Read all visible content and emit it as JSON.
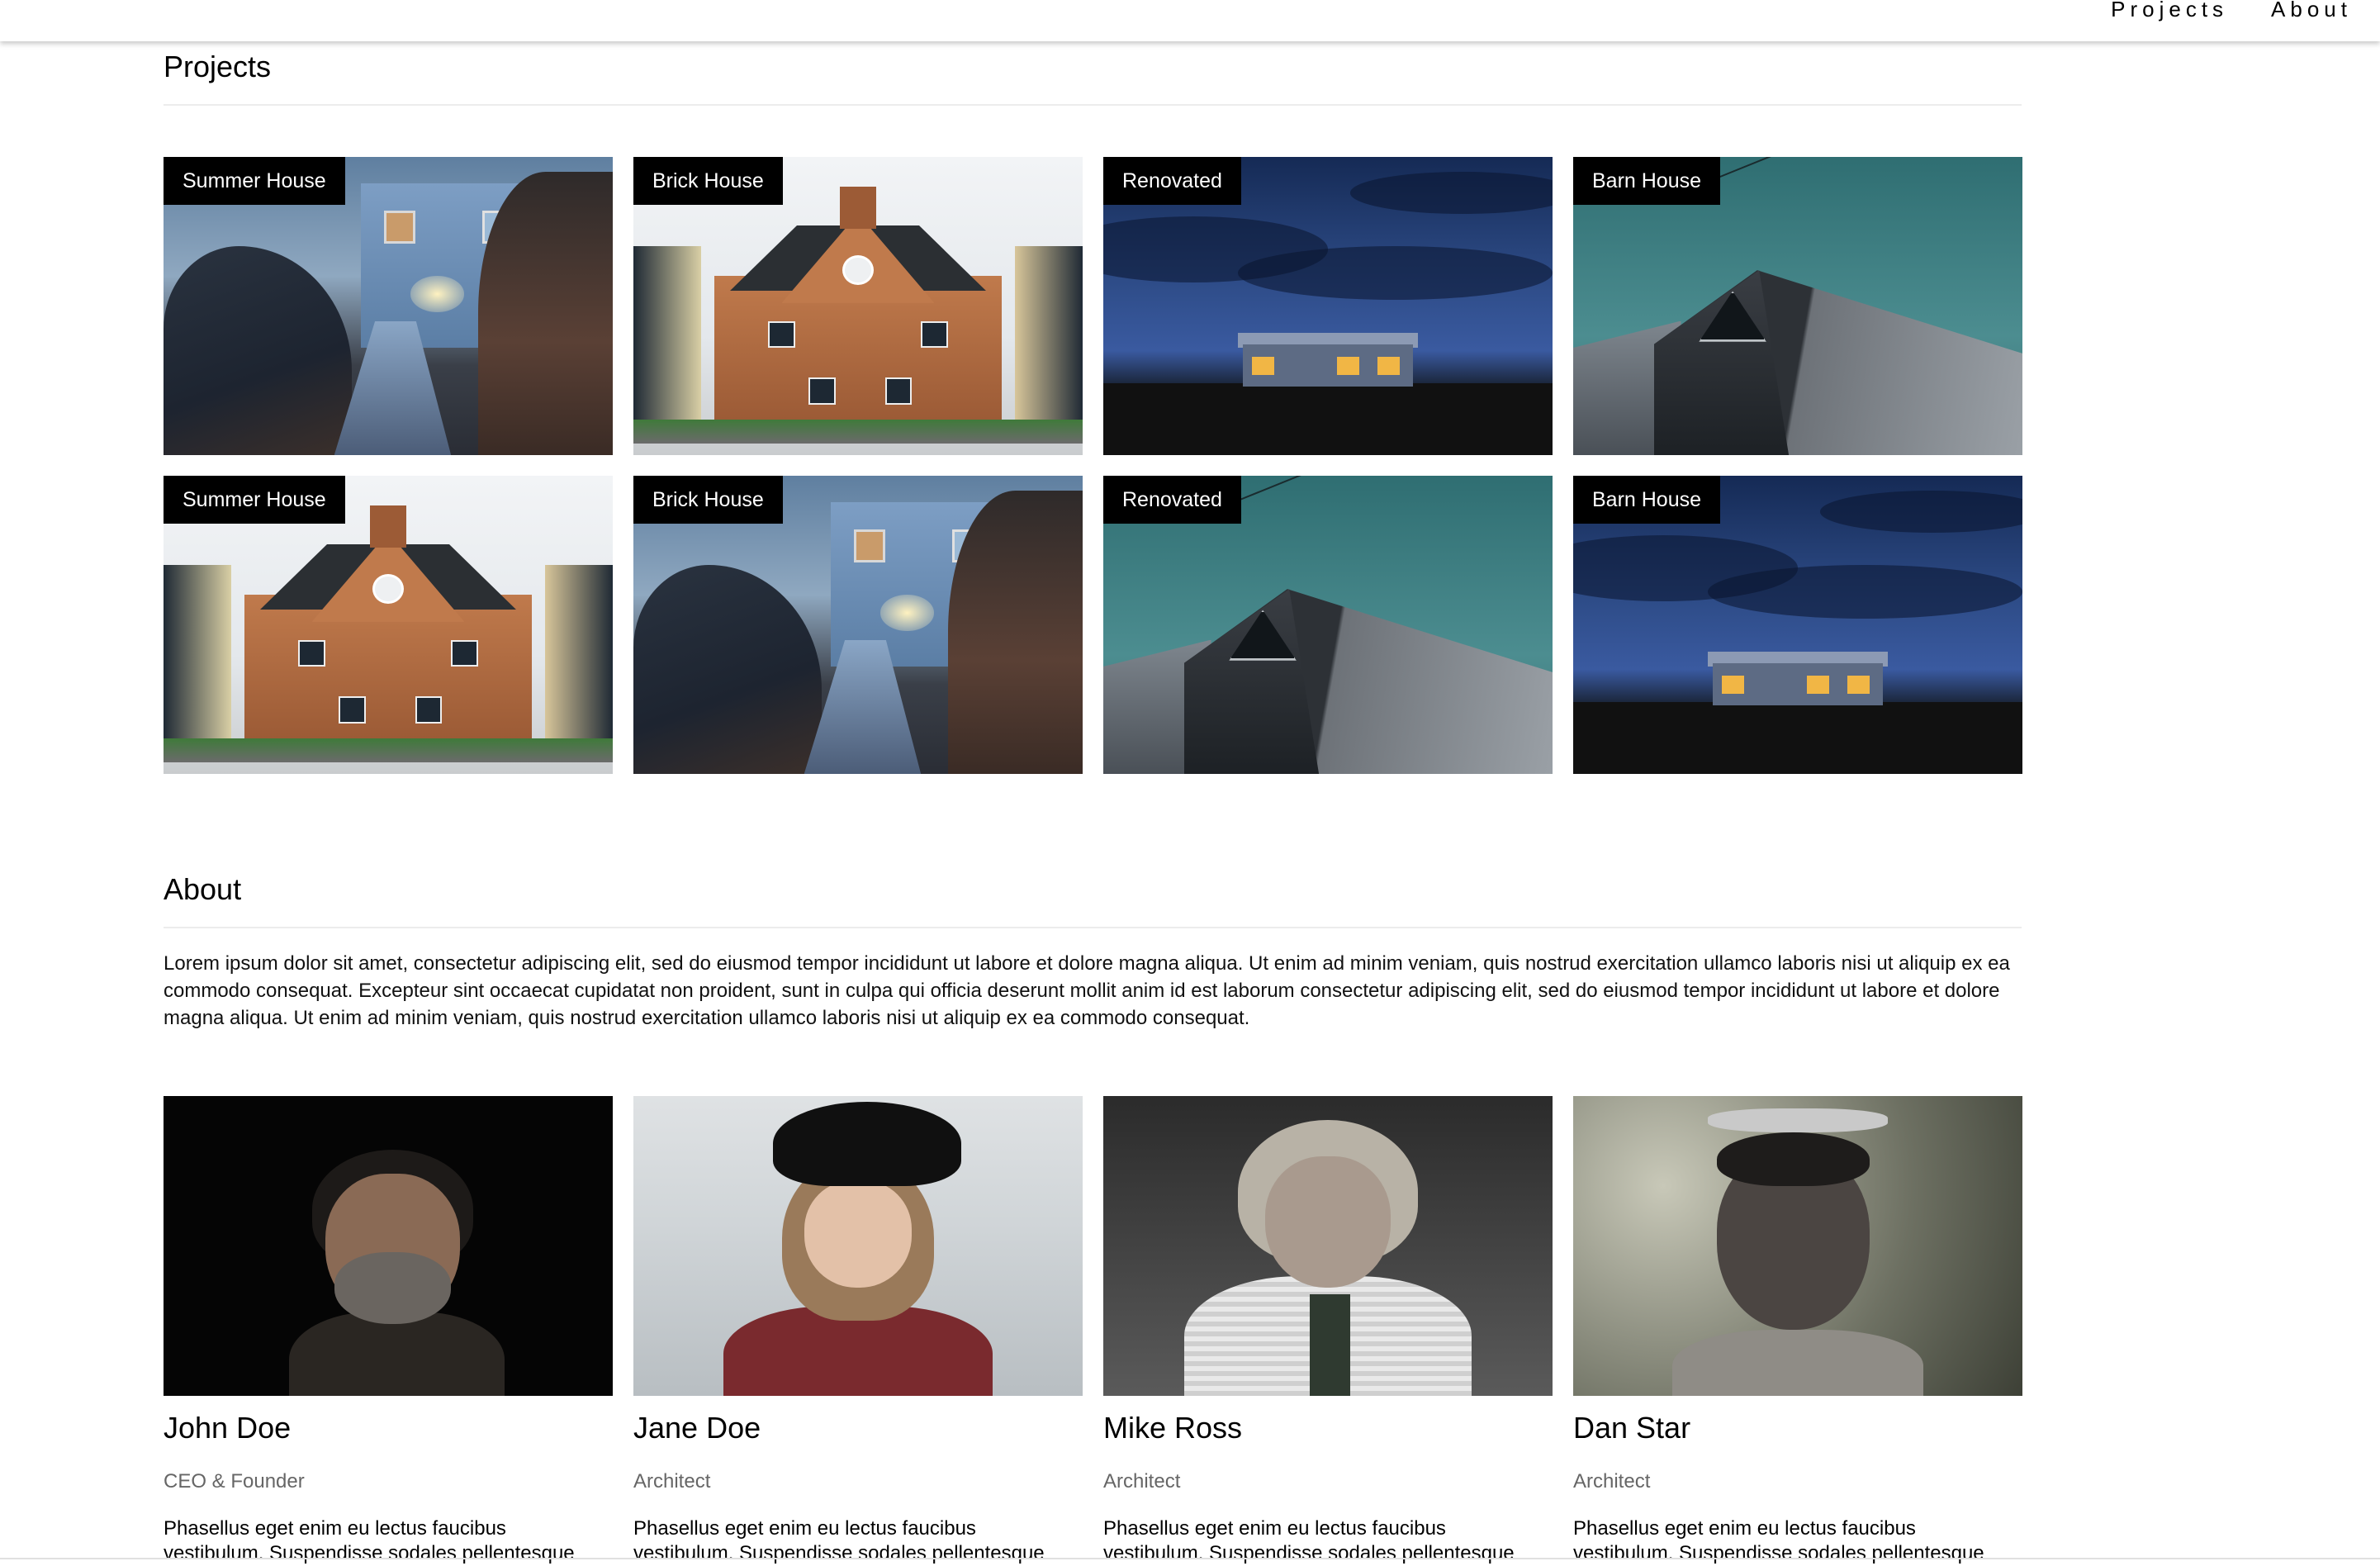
{
  "nav": {
    "links": [
      "Projects",
      "About"
    ]
  },
  "projects": {
    "title": "Projects",
    "items": [
      {
        "label": "Summer House",
        "scene": "summer"
      },
      {
        "label": "Brick House",
        "scene": "brick"
      },
      {
        "label": "Renovated",
        "scene": "night"
      },
      {
        "label": "Barn House",
        "scene": "barn"
      },
      {
        "label": "Summer House",
        "scene": "brick"
      },
      {
        "label": "Brick House",
        "scene": "summer"
      },
      {
        "label": "Renovated",
        "scene": "barn"
      },
      {
        "label": "Barn House",
        "scene": "night"
      }
    ]
  },
  "about": {
    "title": "About",
    "text": "Lorem ipsum dolor sit amet, consectetur adipiscing elit, sed do eiusmod tempor incididunt ut labore et dolore magna aliqua. Ut enim ad minim veniam, quis nostrud exercitation ullamco laboris nisi ut aliquip ex ea commodo consequat. Excepteur sint occaecat cupidatat non proident, sunt in culpa qui officia deserunt mollit anim id est laborum consectetur adipiscing elit, sed do eiusmod tempor incididunt ut labore et dolore magna aliqua. Ut enim ad minim veniam, quis nostrud exercitation ullamco laboris nisi ut aliquip ex ea commodo consequat."
  },
  "team": [
    {
      "name": "John Doe",
      "role": "CEO & Founder",
      "bio": "Phasellus eget enim eu lectus faucibus vestibulum. Suspendisse sodales pellentesque"
    },
    {
      "name": "Jane Doe",
      "role": "Architect",
      "bio": "Phasellus eget enim eu lectus faucibus vestibulum. Suspendisse sodales pellentesque"
    },
    {
      "name": "Mike Ross",
      "role": "Architect",
      "bio": "Phasellus eget enim eu lectus faucibus vestibulum. Suspendisse sodales pellentesque"
    },
    {
      "name": "Dan Star",
      "role": "Architect",
      "bio": "Phasellus eget enim eu lectus faucibus vestibulum. Suspendisse sodales pellentesque"
    }
  ]
}
